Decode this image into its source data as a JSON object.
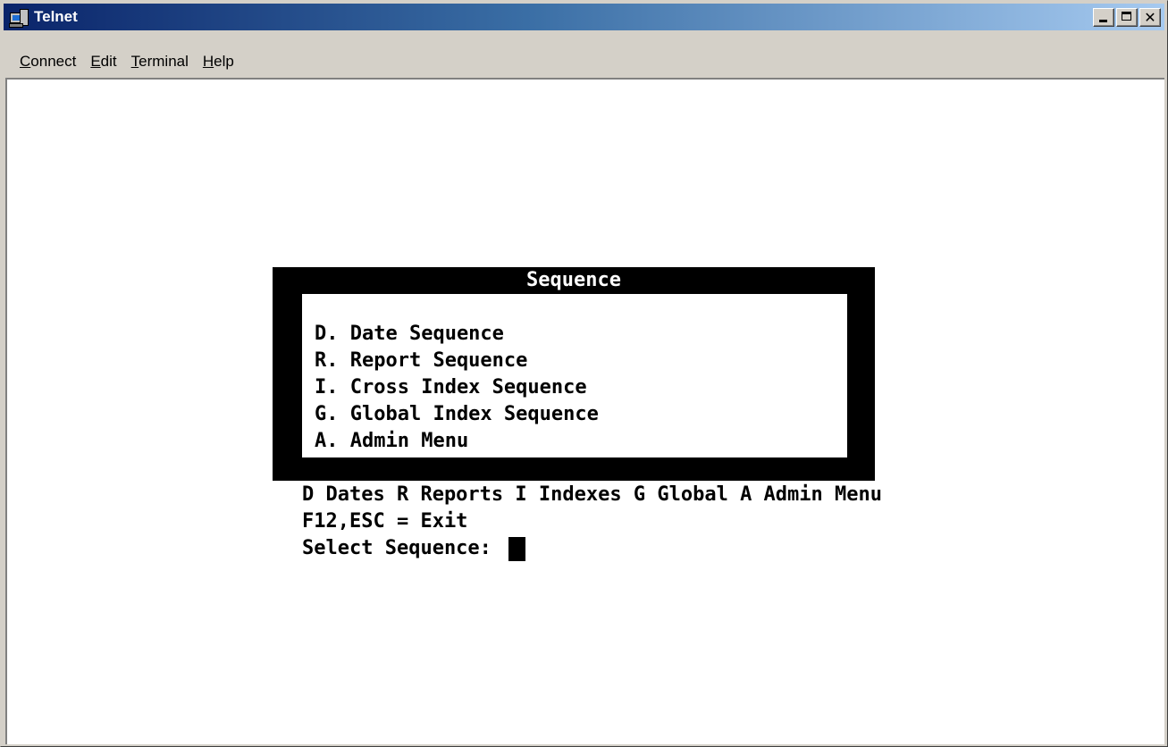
{
  "window": {
    "title": "Telnet",
    "icon": "telnet-computer-icon"
  },
  "menubar": {
    "items": [
      {
        "pre": "",
        "accel": "C",
        "post": "onnect"
      },
      {
        "pre": "",
        "accel": "E",
        "post": "dit"
      },
      {
        "pre": "",
        "accel": "T",
        "post": "erminal"
      },
      {
        "pre": "",
        "accel": "H",
        "post": "elp"
      }
    ]
  },
  "dialog": {
    "title": "Sequence",
    "options": [
      "D. Date Sequence",
      "R. Report Sequence",
      "I. Cross Index Sequence",
      "G. Global Index Sequence",
      "A. Admin Menu"
    ]
  },
  "hint_line": "D Dates R Reports I Indexes G Global A Admin Menu",
  "exit_line": "F12,ESC = Exit",
  "prompt": {
    "label": "Select Sequence: "
  },
  "colors": {
    "titlebar_start": "#0a246a",
    "titlebar_end": "#a6caf0",
    "chrome": "#d4d0c8",
    "terminal_bg": "#ffffff",
    "terminal_fg": "#000000"
  }
}
